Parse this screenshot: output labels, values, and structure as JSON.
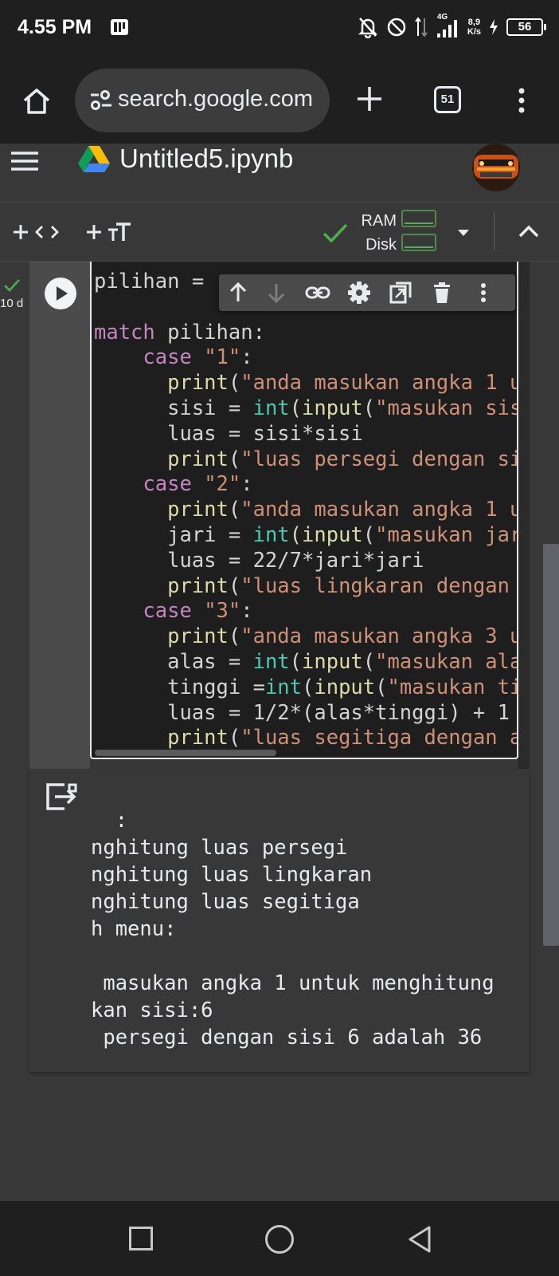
{
  "status_bar": {
    "time": "4.55 PM",
    "net_speed_value": "8,9",
    "net_speed_unit": "K/s",
    "network_type": "4G",
    "battery": "56"
  },
  "browser": {
    "url": "search.google.com",
    "tab_count": "51"
  },
  "colab": {
    "notebook_title": "Untitled5.ipynb",
    "ram_label": "RAM",
    "disk_label": "Disk"
  },
  "cell": {
    "exec_time": "10 d",
    "code_lines": [
      [
        {
          "t": "pilihan = ",
          "c": "plain"
        }
      ],
      [],
      [
        {
          "t": "match",
          "c": "kw"
        },
        {
          "t": " pilihan:",
          "c": "plain"
        }
      ],
      [
        {
          "t": "    ",
          "c": "plain"
        },
        {
          "t": "case",
          "c": "kw"
        },
        {
          "t": " ",
          "c": "plain"
        },
        {
          "t": "\"1\"",
          "c": "str"
        },
        {
          "t": ":",
          "c": "plain"
        }
      ],
      [
        {
          "t": "      ",
          "c": "plain"
        },
        {
          "t": "print",
          "c": "fn"
        },
        {
          "t": "(",
          "c": "plain"
        },
        {
          "t": "\"anda masukan angka 1 u",
          "c": "str"
        }
      ],
      [
        {
          "t": "      sisi = ",
          "c": "plain"
        },
        {
          "t": "int",
          "c": "type"
        },
        {
          "t": "(",
          "c": "plain"
        },
        {
          "t": "input",
          "c": "fn"
        },
        {
          "t": "(",
          "c": "plain"
        },
        {
          "t": "\"masukan sis",
          "c": "str"
        }
      ],
      [
        {
          "t": "      luas = sisi*sisi",
          "c": "plain"
        }
      ],
      [
        {
          "t": "      ",
          "c": "plain"
        },
        {
          "t": "print",
          "c": "fn"
        },
        {
          "t": "(",
          "c": "plain"
        },
        {
          "t": "\"luas persegi dengan si",
          "c": "str"
        }
      ],
      [
        {
          "t": "    ",
          "c": "plain"
        },
        {
          "t": "case",
          "c": "kw"
        },
        {
          "t": " ",
          "c": "plain"
        },
        {
          "t": "\"2\"",
          "c": "str"
        },
        {
          "t": ":",
          "c": "plain"
        }
      ],
      [
        {
          "t": "      ",
          "c": "plain"
        },
        {
          "t": "print",
          "c": "fn"
        },
        {
          "t": "(",
          "c": "plain"
        },
        {
          "t": "\"anda masukan angka 1 u",
          "c": "str"
        }
      ],
      [
        {
          "t": "      jari = ",
          "c": "plain"
        },
        {
          "t": "int",
          "c": "type"
        },
        {
          "t": "(",
          "c": "plain"
        },
        {
          "t": "input",
          "c": "fn"
        },
        {
          "t": "(",
          "c": "plain"
        },
        {
          "t": "\"masukan jar",
          "c": "str"
        }
      ],
      [
        {
          "t": "      luas = 22/7*jari*jari",
          "c": "plain"
        }
      ],
      [
        {
          "t": "      ",
          "c": "plain"
        },
        {
          "t": "print",
          "c": "fn"
        },
        {
          "t": "(",
          "c": "plain"
        },
        {
          "t": "\"luas lingkaran dengan",
          "c": "str"
        }
      ],
      [
        {
          "t": "    ",
          "c": "plain"
        },
        {
          "t": "case",
          "c": "kw"
        },
        {
          "t": " ",
          "c": "plain"
        },
        {
          "t": "\"3\"",
          "c": "str"
        },
        {
          "t": ":",
          "c": "plain"
        }
      ],
      [
        {
          "t": "      ",
          "c": "plain"
        },
        {
          "t": "print",
          "c": "fn"
        },
        {
          "t": "(",
          "c": "plain"
        },
        {
          "t": "\"anda masukan angka 3 u",
          "c": "str"
        }
      ],
      [
        {
          "t": "      alas = ",
          "c": "plain"
        },
        {
          "t": "int",
          "c": "type"
        },
        {
          "t": "(",
          "c": "plain"
        },
        {
          "t": "input",
          "c": "fn"
        },
        {
          "t": "(",
          "c": "plain"
        },
        {
          "t": "\"masukan ala",
          "c": "str"
        }
      ],
      [
        {
          "t": "      tinggi =",
          "c": "plain"
        },
        {
          "t": "int",
          "c": "type"
        },
        {
          "t": "(",
          "c": "plain"
        },
        {
          "t": "input",
          "c": "fn"
        },
        {
          "t": "(",
          "c": "plain"
        },
        {
          "t": "\"masukan ti",
          "c": "str"
        }
      ],
      [
        {
          "t": "      luas = 1/2*(alas*tinggi) + 1",
          "c": "plain"
        }
      ],
      [
        {
          "t": "      ",
          "c": "plain"
        },
        {
          "t": "print",
          "c": "fn"
        },
        {
          "t": "(",
          "c": "plain"
        },
        {
          "t": "\"luas segitiga dengan a",
          "c": "str"
        }
      ]
    ]
  },
  "output": {
    "lines": [
      "  :",
      "nghitung luas persegi",
      "nghitung luas lingkaran",
      "nghitung luas segitiga",
      "h menu:",
      "",
      " masukan angka 1 untuk menghitung",
      "kan sisi:6",
      " persegi dengan sisi 6 adalah 36"
    ]
  },
  "colors": {
    "keyword": "#c586c0",
    "string": "#ce9178",
    "function": "#dcdcaa",
    "builtin_type": "#4ec9b0",
    "success_check": "#4caf50"
  }
}
